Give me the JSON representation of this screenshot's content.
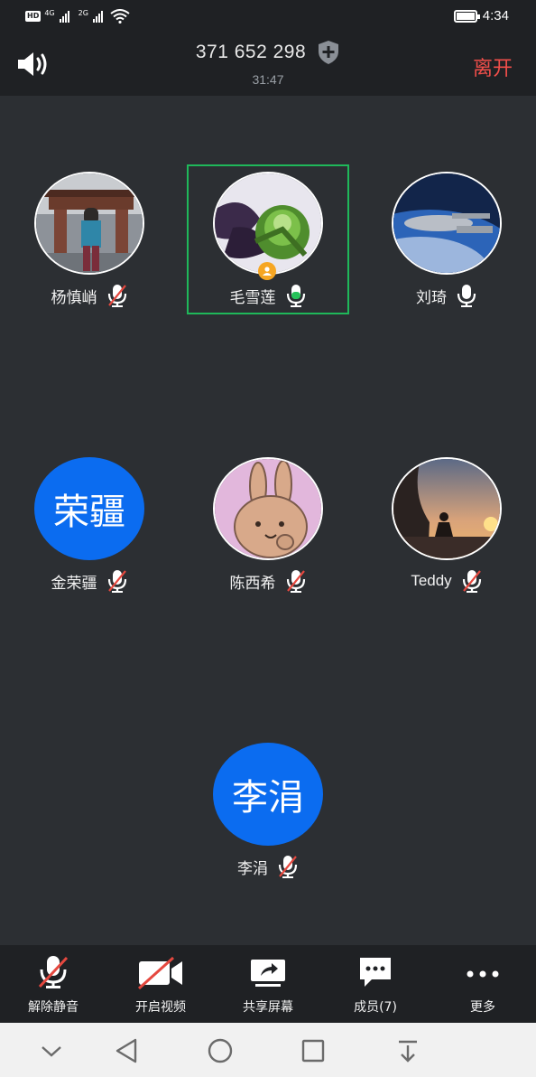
{
  "status_bar": {
    "hd": "HD",
    "net1": "4G",
    "net2": "2G",
    "time": "4:34"
  },
  "header": {
    "meeting_id": "371 652 298",
    "duration": "31:47",
    "leave_label": "离开"
  },
  "participants": [
    {
      "name": "杨慎峭",
      "avatar_type": "photo",
      "avatar_subject": "woman standing before gate",
      "mic": "muted"
    },
    {
      "name": "毛雪莲",
      "avatar_type": "photo",
      "avatar_subject": "succulent plant",
      "mic": "active",
      "host": true,
      "active_speaker": true
    },
    {
      "name": "刘琦",
      "avatar_type": "photo",
      "avatar_subject": "starship over earth",
      "mic": "on"
    },
    {
      "name": "金荣疆",
      "avatar_type": "text",
      "avatar_text": "荣疆",
      "mic": "muted"
    },
    {
      "name": "陈西希",
      "avatar_type": "photo",
      "avatar_subject": "cartoon bunny",
      "mic": "muted"
    },
    {
      "name": "Teddy",
      "avatar_type": "photo",
      "avatar_subject": "silhouette at sunset",
      "mic": "muted"
    },
    {
      "name": "李涓",
      "avatar_type": "text",
      "avatar_text": "李涓",
      "mic": "muted"
    }
  ],
  "toolbar": {
    "unmute": "解除静音",
    "start_video": "开启视频",
    "share_screen": "共享屏幕",
    "members": "成员(7)",
    "more": "更多"
  },
  "colors": {
    "background": "#2c2f33",
    "bar": "#1f2124",
    "leave": "#f04e4a",
    "avatar_blue": "#0b6cf0",
    "active_green": "#1fb85a",
    "muted_red": "#e5483f"
  }
}
